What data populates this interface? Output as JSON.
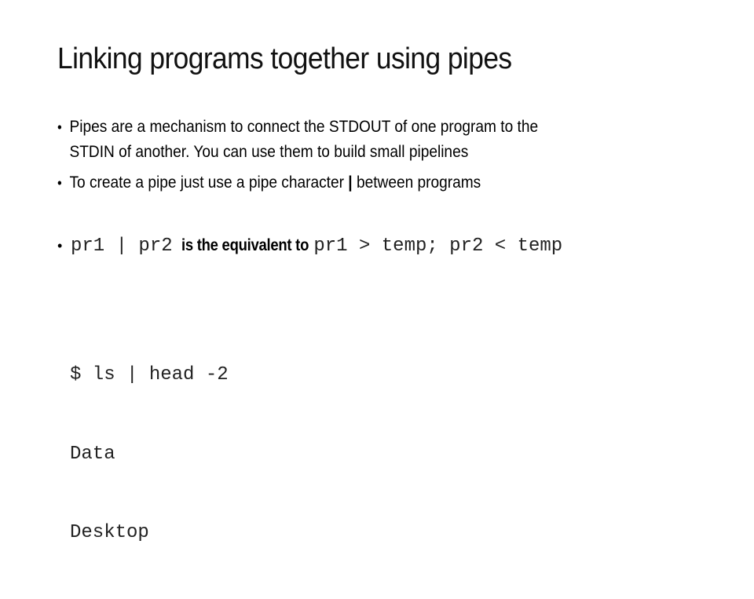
{
  "slide": {
    "title": "Linking programs together using pipes",
    "bullets": [
      {
        "marker": "•",
        "line1": "Pipes are a mechanism to connect the STDOUT of one program to the",
        "line2": "STDIN of another. You can use them to build small pipelines"
      },
      {
        "marker": "•",
        "text_before": "To create a pipe just use a pipe character ",
        "pipe": "|",
        "text_after": " between programs"
      },
      {
        "marker": "•",
        "code1": "pr1 | pr2",
        "middle": "is the equivalent to",
        "code2": "pr1 > temp; pr2 < temp"
      }
    ],
    "code_example": {
      "lines": [
        "$ ls | head -2",
        "Data",
        "Desktop"
      ]
    }
  }
}
